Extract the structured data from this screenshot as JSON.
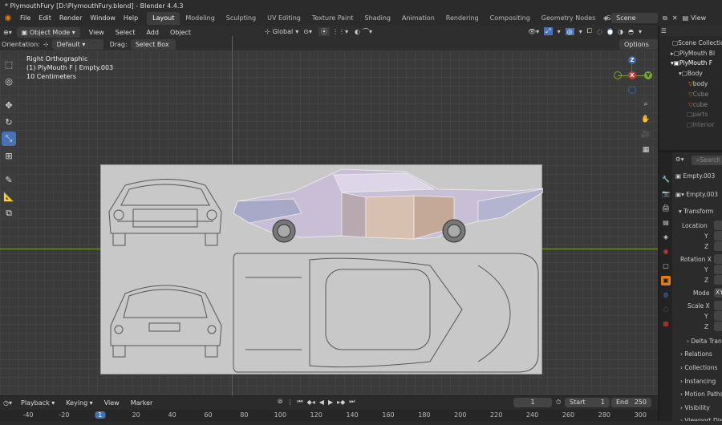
{
  "window": {
    "title": "* PlymouthFury [D:\\PlymouthFury.blend] - Blender 4.4.3"
  },
  "menu": [
    "File",
    "Edit",
    "Render",
    "Window",
    "Help"
  ],
  "workspaces": [
    "Layout",
    "Modeling",
    "Sculpting",
    "UV Editing",
    "Texture Paint",
    "Shading",
    "Animation",
    "Rendering",
    "Compositing",
    "Geometry Nodes",
    "Scripting"
  ],
  "active_workspace": "Layout",
  "scene": {
    "name": "Scene",
    "view_layer": "View"
  },
  "header": {
    "mode": "Object Mode",
    "menus": [
      "View",
      "Select",
      "Add",
      "Object"
    ],
    "transform_orientation": "Global"
  },
  "tool_settings": {
    "orientation_label": "Orientation:",
    "orientation_value": "Default",
    "drag_label": "Drag:",
    "drag_value": "Select Box",
    "options": "Options"
  },
  "viewport": {
    "view_name": "Right Orthographic",
    "object_info": "(1) PlyMouth F | Empty.003",
    "scale_info": "10 Centimeters"
  },
  "gizmo": {
    "x": "X",
    "y": "Y",
    "z": "Z"
  },
  "outliner": {
    "rows": [
      {
        "label": "Scene Collection",
        "indent": 0
      },
      {
        "label": "PlyMouth Bl",
        "indent": 1
      },
      {
        "label": "PlyMouth F",
        "indent": 1
      },
      {
        "label": "Body",
        "indent": 2
      },
      {
        "label": "body",
        "indent": 3
      },
      {
        "label": "Cube",
        "indent": 3
      },
      {
        "label": "cube",
        "indent": 3
      },
      {
        "label": "parts",
        "indent": 2
      },
      {
        "label": "Interior",
        "indent": 2
      }
    ]
  },
  "properties": {
    "search_placeholder": "Search",
    "object_name": "Empty.003",
    "data_name": "Empty.003",
    "transform_label": "Transform",
    "location_label": "Location",
    "y_label": "Y",
    "z_label": "Z",
    "rotation_label": "Rotation X",
    "mode_label": "Mode",
    "mode_value": "XY",
    "scale_label": "Scale X",
    "scale_y": "Y",
    "scale_z": "Z",
    "panels": [
      "Delta Transform",
      "Relations",
      "Collections",
      "Instancing",
      "Motion Paths",
      "Visibility",
      "Viewport Display"
    ]
  },
  "timeline": {
    "playback": "Playback",
    "keying": "Keying",
    "view": "View",
    "marker": "Marker",
    "current_frame": "1",
    "start_label": "Start",
    "start_value": "1",
    "end_label": "End",
    "end_value": "250",
    "ruler_ticks": [
      "-40",
      "-20",
      "1",
      "20",
      "40",
      "60",
      "80",
      "100",
      "120",
      "140",
      "160",
      "180",
      "200",
      "220",
      "240",
      "260",
      "280",
      "300"
    ]
  },
  "colors": {
    "accent": "#4772b3",
    "x_axis": "#c83a3a",
    "y_axis": "#7aa33a",
    "z_axis": "#3a64a8",
    "orange": "#e87d0d"
  }
}
